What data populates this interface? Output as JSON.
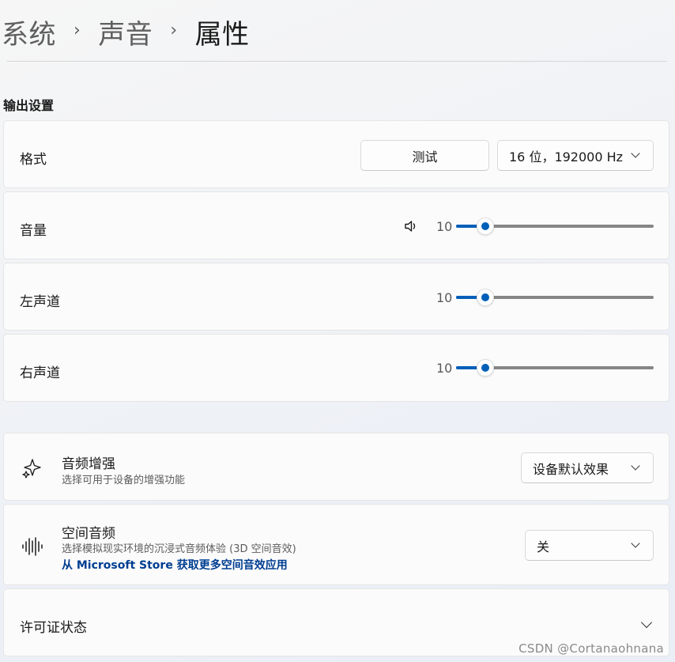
{
  "breadcrumb": {
    "items": [
      "系统",
      "声音"
    ],
    "separator": "›",
    "current": "属性"
  },
  "output_section": {
    "title": "输出设置",
    "format": {
      "label": "格式",
      "test_button": "测试",
      "dropdown_value": "16 位，192000 Hz"
    },
    "volume": {
      "label": "音量",
      "icon": "speaker-icon",
      "value": "10",
      "level": 10
    },
    "left_channel": {
      "label": "左声道",
      "value": "10",
      "level": 10
    },
    "right_channel": {
      "label": "右声道",
      "value": "10",
      "level": 10
    }
  },
  "enhancements": {
    "audio_enhancement": {
      "icon": "sparkle-icon",
      "title": "音频增强",
      "subtitle": "选择可用于设备的增强功能",
      "dropdown_value": "设备默认效果"
    },
    "spatial_audio": {
      "icon": "sound-wave-icon",
      "title": "空间音频",
      "subtitle": "选择模拟现实环境的沉浸式音频体验 (3D 空间音效)",
      "link": "从 Microsoft Store 获取更多空间音效应用",
      "dropdown_value": "关"
    },
    "license": {
      "label": "许可证状态"
    }
  },
  "watermark": "CSDN @Cortanaohnana",
  "colors": {
    "accent": "#005fb8",
    "link": "#003e92",
    "background": "#f3f3f3",
    "card": "#fbfbfb"
  }
}
